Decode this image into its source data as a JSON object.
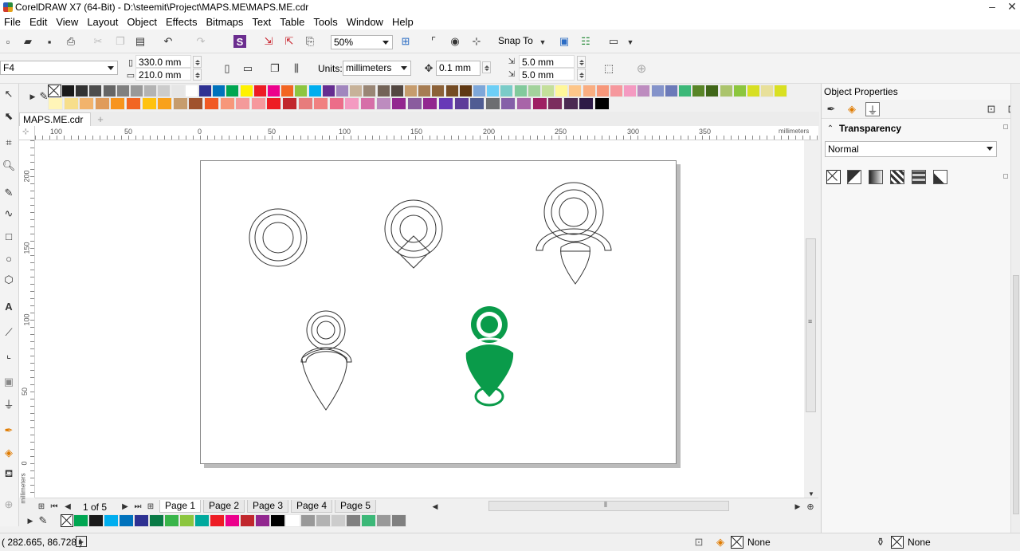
{
  "window": {
    "title": "CorelDRAW X7 (64-Bit) - D:\\steemit\\Project\\MAPS.ME\\MAPS.ME.cdr"
  },
  "menu": [
    "File",
    "Edit",
    "View",
    "Layout",
    "Object",
    "Effects",
    "Bitmaps",
    "Text",
    "Table",
    "Tools",
    "Window",
    "Help"
  ],
  "toolbar": {
    "zoom": "50%",
    "snap_label": "Snap To"
  },
  "propbar": {
    "page_size": "F4",
    "width": "330.0 mm",
    "height": "210.0 mm",
    "units_label": "Units:",
    "units": "millimeters",
    "nudge": "0.1 mm",
    "dup_x": "5.0 mm",
    "dup_y": "5.0 mm"
  },
  "document": {
    "tab": "MAPS.ME.cdr"
  },
  "ruler": {
    "unit": "millimeters",
    "h_ticks": [
      "100",
      "50",
      "0",
      "50",
      "100",
      "150",
      "200",
      "250",
      "300",
      "350"
    ],
    "v_ticks": [
      "200",
      "150",
      "100",
      "50",
      "0"
    ],
    "v_unit": "millimeters"
  },
  "pages": {
    "counter": "1 of 5",
    "tabs": [
      "Page 1",
      "Page 2",
      "Page 3",
      "Page 4",
      "Page 5"
    ],
    "active": 0
  },
  "object_properties": {
    "title": "Object Properties",
    "section": "Transparency",
    "merge_mode": "Normal"
  },
  "status": {
    "coords": "( 282.665, 86.728 )",
    "fill": "None",
    "outline": "None"
  },
  "colors": {
    "accent_green": "#0a9b4a"
  },
  "palette_top_row1": [
    "#1a1a1a",
    "#333333",
    "#4d4d4d",
    "#666666",
    "#808080",
    "#999999",
    "#b3b3b3",
    "#cccccc",
    "#e6e6e6",
    "#ffffff",
    "#2e3192",
    "#0072bc",
    "#00a651",
    "#fff200",
    "#ed1c24",
    "#ec008c",
    "#f26522",
    "#8dc63f",
    "#00aeef",
    "#662d91",
    "#a186be",
    "#c7b299",
    "#998675",
    "#736357",
    "#534741",
    "#c69c6d",
    "#a67c52",
    "#8c6239",
    "#754c24",
    "#603913",
    "#7da7d9",
    "#6dcff6",
    "#7accc8",
    "#82ca9c",
    "#a3d39c",
    "#c4df9b",
    "#fff799",
    "#fdc689",
    "#f9ad81",
    "#f7977a",
    "#f6989d",
    "#f49ac1",
    "#bd8cbf",
    "#8493ca",
    "#6c7ab9",
    "#3cb878",
    "#598527",
    "#406618",
    "#abc46c",
    "#8cc63e",
    "#d7df23",
    "#e8e09a",
    "#d9e021"
  ],
  "palette_top_row2": [
    "#fff5b8",
    "#f7de8b",
    "#f2b36c",
    "#e09b5a",
    "#f7941d",
    "#f26522",
    "#ffc20e",
    "#f9a11b",
    "#c69c6d",
    "#a0522d",
    "#f15a24",
    "#f7977a",
    "#f49a9a",
    "#f6989d",
    "#ed1c24",
    "#c1272d",
    "#e77c7c",
    "#f08080",
    "#ec6d89",
    "#f49ac1",
    "#d66fa8",
    "#bd8cbf",
    "#93278f",
    "#8a5c9e",
    "#92278f",
    "#673ab7",
    "#5e3c99",
    "#505c93",
    "#6d6e71",
    "#8560a8",
    "#a864a8",
    "#9e1f63",
    "#7b2e5e",
    "#4b2a52",
    "#2e1a47",
    "#000000"
  ],
  "palette_bottom": [
    "#00a651",
    "#1a1a1a",
    "#00aeef",
    "#0072bc",
    "#2e3192",
    "#0a7a46",
    "#39b54a",
    "#8cc63f",
    "#00a99d",
    "#ed1c24",
    "#ec008c",
    "#c1272d",
    "#92278f",
    "#000000",
    "#ffffff",
    "#999999",
    "#b3b3b3",
    "#cccccc",
    "#808080",
    "#3cb878",
    "#999999",
    "#808080"
  ]
}
